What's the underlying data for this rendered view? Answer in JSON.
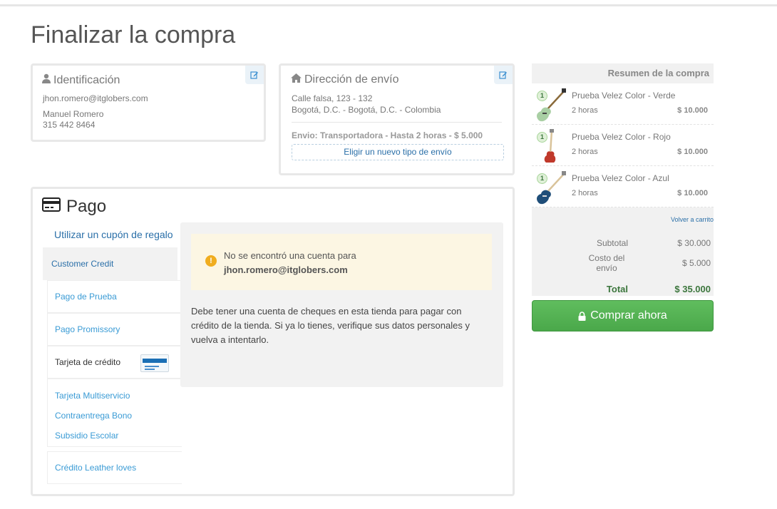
{
  "page": {
    "title": "Finalizar la compra"
  },
  "identification": {
    "title": "Identificación",
    "email": "jhon.romero@itglobers.com",
    "name": "Manuel Romero",
    "phone": "315 442 8464"
  },
  "shipping": {
    "title": "Dirección de envío",
    "address_line1": "Calle falsa, 123 - 132",
    "address_line2": "Bogotá, D.C. - Bogotá, D.C. - Colombia",
    "method": "Envio: Transportadora - Hasta 2 horas - $ 5.000",
    "change_label": "Eligir un nuevo tipo de envío"
  },
  "payment": {
    "title": "Pago",
    "coupon_link": "Utilizar un cupón de regalo",
    "methods": {
      "customer_credit": "Customer Credit",
      "pago_prueba": "Pago de Prueba",
      "pago_promissory": "Pago Promissory",
      "tarjeta_credito": "Tarjeta de crédito",
      "tarjeta_multiservicio": "Tarjeta Multiservicio",
      "contraentrega_bono": "Contraentrega Bono",
      "subsidio_escolar": "Subsidio Escolar",
      "credito_leather": "Crédito Leather loves"
    },
    "warning_text": "No se encontró una cuenta para",
    "warning_email": "jhon.romero@itglobers.com",
    "message": "Debe tener una cuenta de cheques en esta tienda para pagar con crédito de la tienda. Si ya lo tienes, verifique sus datos personales y vuelva a intentarlo."
  },
  "summary": {
    "title": "Resumen de la compra",
    "items": [
      {
        "qty": "1",
        "name": "Prueba Velez Color - Verde",
        "time": "2 horas",
        "price": "$ 10.000",
        "color": "#a9cfa4"
      },
      {
        "qty": "1",
        "name": "Prueba Velez Color - Rojo",
        "time": "2 horas",
        "price": "$ 10.000",
        "color": "#c0392b"
      },
      {
        "qty": "1",
        "name": "Prueba Velez Color - Azul",
        "time": "2 horas",
        "price": "$ 10.000",
        "color": "#1f4e79"
      }
    ],
    "back_to_cart": "Volver a carrito",
    "subtotal_label": "Subtotal",
    "subtotal_value": "$ 30.000",
    "shipping_label": "Costo del envío",
    "shipping_value": "$ 5.000",
    "total_label": "Total",
    "total_value": "$ 35.000",
    "buy_label": "Comprar ahora"
  }
}
